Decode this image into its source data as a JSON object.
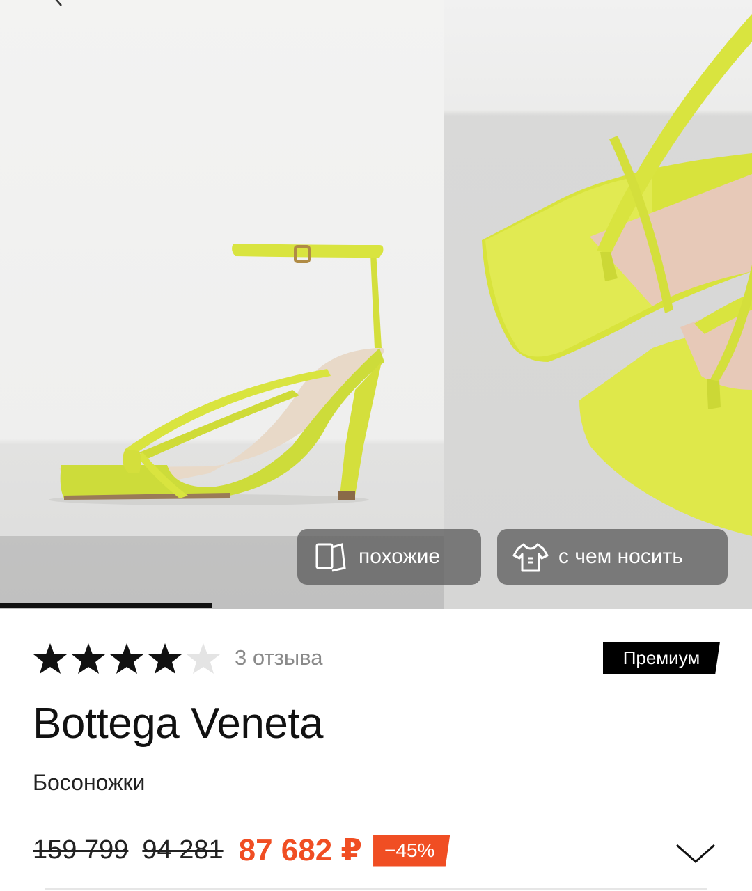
{
  "gallery": {
    "buttons": {
      "similar_label": "похожие",
      "wear_with_label": "с чем носить"
    },
    "icons": {
      "back": "back-arrow-icon",
      "similar": "similar-cards-icon",
      "wear": "tshirt-icon"
    }
  },
  "product": {
    "rating": 4,
    "rating_max": 5,
    "reviews_label": "3 отзыва",
    "badge": "Премиум",
    "brand": "Bottega Veneta",
    "category": "Босоножки",
    "prices": {
      "old_1": "159 799",
      "old_2": "94 281",
      "current": "87 682 ₽",
      "discount": "−45%"
    },
    "colors": {
      "accent": "#f04e23",
      "sandal": "#d8e23a"
    }
  }
}
